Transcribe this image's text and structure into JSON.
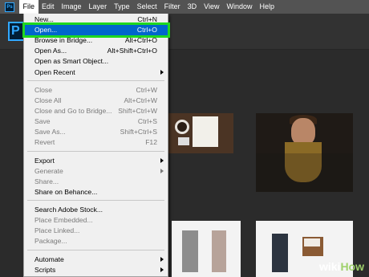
{
  "menubar": {
    "logo": "Ps",
    "items": [
      "File",
      "Edit",
      "Image",
      "Layer",
      "Type",
      "Select",
      "Filter",
      "3D",
      "View",
      "Window",
      "Help"
    ]
  },
  "home": {
    "logo": "P"
  },
  "file_menu": {
    "items": [
      {
        "label": "New...",
        "shortcut": "Ctrl+N"
      },
      {
        "label": "Open...",
        "shortcut": "Ctrl+O"
      },
      {
        "label": "Browse in Bridge...",
        "shortcut": "Alt+Ctrl+O"
      },
      {
        "label": "Open As...",
        "shortcut": "Alt+Shift+Ctrl+O"
      },
      {
        "label": "Open as Smart Object...",
        "shortcut": ""
      },
      {
        "label": "Open Recent",
        "shortcut": ""
      },
      {
        "label": "Close",
        "shortcut": "Ctrl+W"
      },
      {
        "label": "Close All",
        "shortcut": "Alt+Ctrl+W"
      },
      {
        "label": "Close and Go to Bridge...",
        "shortcut": "Shift+Ctrl+W"
      },
      {
        "label": "Save",
        "shortcut": "Ctrl+S"
      },
      {
        "label": "Save As...",
        "shortcut": "Shift+Ctrl+S"
      },
      {
        "label": "Revert",
        "shortcut": "F12"
      },
      {
        "label": "Export",
        "shortcut": ""
      },
      {
        "label": "Generate",
        "shortcut": ""
      },
      {
        "label": "Share...",
        "shortcut": ""
      },
      {
        "label": "Share on Behance...",
        "shortcut": ""
      },
      {
        "label": "Search Adobe Stock...",
        "shortcut": ""
      },
      {
        "label": "Place Embedded...",
        "shortcut": ""
      },
      {
        "label": "Place Linked...",
        "shortcut": ""
      },
      {
        "label": "Package...",
        "shortcut": ""
      },
      {
        "label": "Automate",
        "shortcut": ""
      },
      {
        "label": "Scripts",
        "shortcut": ""
      }
    ]
  },
  "watermark": {
    "wiki": "wiki",
    "how": "How"
  },
  "colors": {
    "highlight": "#0066cc",
    "callout": "#1fd81f",
    "menubar": "#535353"
  }
}
